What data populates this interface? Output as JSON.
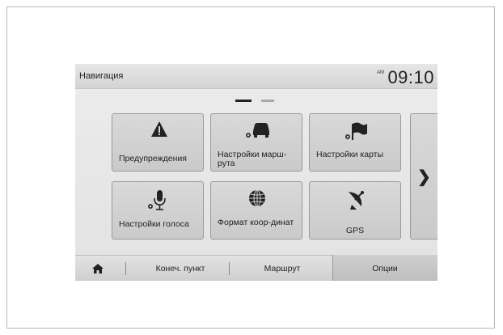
{
  "header": {
    "title": "Навигация",
    "am_pm": "AM",
    "clock": "09:10"
  },
  "pager": {
    "pages": 2,
    "current": 1
  },
  "menu": {
    "items": [
      {
        "label": "Предупреждения",
        "icon": "warning-icon"
      },
      {
        "label": "Настройки марш-рута",
        "icon": "route-settings-icon"
      },
      {
        "label": "Настройки карты",
        "icon": "map-settings-icon"
      },
      {
        "label": "Настройки голоса",
        "icon": "voice-settings-icon"
      },
      {
        "label": "Формат коор-динат",
        "icon": "globe-icon"
      },
      {
        "label": "GPS",
        "icon": "satellite-icon"
      }
    ],
    "next_icon": "chevron-right-icon"
  },
  "tabs": {
    "home_icon": "home-icon",
    "items": [
      {
        "label": "Конеч. пункт"
      },
      {
        "label": "Маршрут"
      },
      {
        "label": "Опции"
      }
    ],
    "active": "Опции"
  }
}
